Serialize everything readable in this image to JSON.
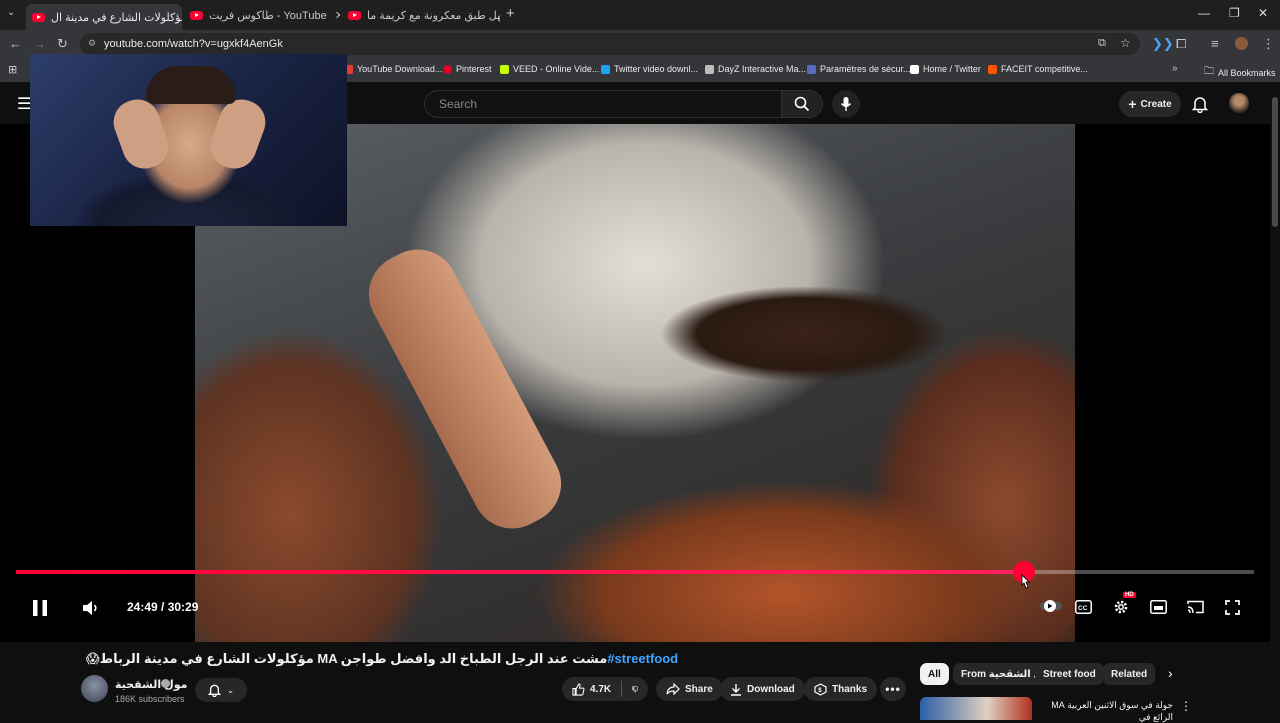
{
  "browser": {
    "tabs": [
      {
        "title": "مؤكلولات الشارع في مدينة ال",
        "active": true,
        "audio": true
      },
      {
        "title": "طاكوس فريت - YouTube",
        "active": false
      },
      {
        "title": "أسهل طبق معكرونة مع كريمة ما",
        "active": false
      }
    ],
    "new_tab": "+",
    "url": "youtube.com/watch?v=ugxkf4AenGk",
    "bookmarks": [
      {
        "label": "YouTube Download...",
        "icon": "youtube-downloader-icon",
        "color": "#e53935"
      },
      {
        "label": "Pinterest",
        "icon": "pinterest-icon",
        "color": "#e60023"
      },
      {
        "label": "VEED - Online Vide...",
        "icon": "veed-icon",
        "color": "#c6ff00"
      },
      {
        "label": "Twitter video downl...",
        "icon": "twitter-downloader-icon",
        "color": "#1da1f2"
      },
      {
        "label": "DayZ Interactive Ma...",
        "icon": "dayz-icon",
        "color": "#bdbdbd"
      },
      {
        "label": "Paramètres de sécur...",
        "icon": "shield-icon",
        "color": "#5c6bc0"
      },
      {
        "label": "Home / Twitter",
        "icon": "x-icon",
        "color": "#ffffff"
      },
      {
        "label": "FACEIT competitive...",
        "icon": "faceit-icon",
        "color": "#ff5500"
      }
    ],
    "all_bookmarks": "All Bookmarks"
  },
  "youtube": {
    "search_placeholder": "Search",
    "create_label": "Create"
  },
  "player": {
    "time": "24:49 / 30:29",
    "progress": 0.8139,
    "hd_badge": "HD"
  },
  "video": {
    "title_hashtag": "#streetfood",
    "title_text": "مؤكلولات الشارع في مدينة الرباط MA مشت عند الرجل الطباخ الد وافضل طواجن",
    "title_emoji": "😱",
    "channel_name": "مول الشقحية",
    "channel_subs": "186K subscribers",
    "likes": "4.7K",
    "share_label": "Share",
    "download_label": "Download",
    "thanks_label": "Thanks"
  },
  "sidebar": {
    "chips": [
      "All",
      "From مول الشقحية",
      "Street food",
      "Related"
    ],
    "recommendation_title": "جولة في سوق الاثنين العربية MA الرائع في"
  },
  "colors": {
    "accent": "#ff0033",
    "link": "#3ea6ff",
    "background": "#0f0f0f"
  }
}
